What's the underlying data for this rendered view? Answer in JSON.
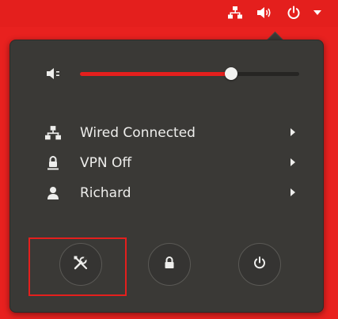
{
  "panel": {
    "tray_icons": [
      "network-wired-icon",
      "speaker-volume-icon",
      "power-icon",
      "dropdown-arrow-icon"
    ]
  },
  "system_menu": {
    "volume": {
      "icon": "speaker-muted-icon",
      "level_fraction": 0.69
    },
    "items": [
      {
        "icon": "network-wired-icon",
        "label": "Wired Connected"
      },
      {
        "icon": "vpn-lock-icon",
        "label": "VPN Off"
      },
      {
        "icon": "user-icon",
        "label": "Richard"
      }
    ],
    "actions": [
      {
        "icon": "settings-tools-icon",
        "highlighted": true
      },
      {
        "icon": "lock-icon"
      },
      {
        "icon": "power-off-icon"
      }
    ]
  },
  "colors": {
    "panel_red": "#e41f1d",
    "menu_bg": "#3a3936",
    "text": "#eeeeec",
    "highlight_box": "#e41f1d"
  }
}
